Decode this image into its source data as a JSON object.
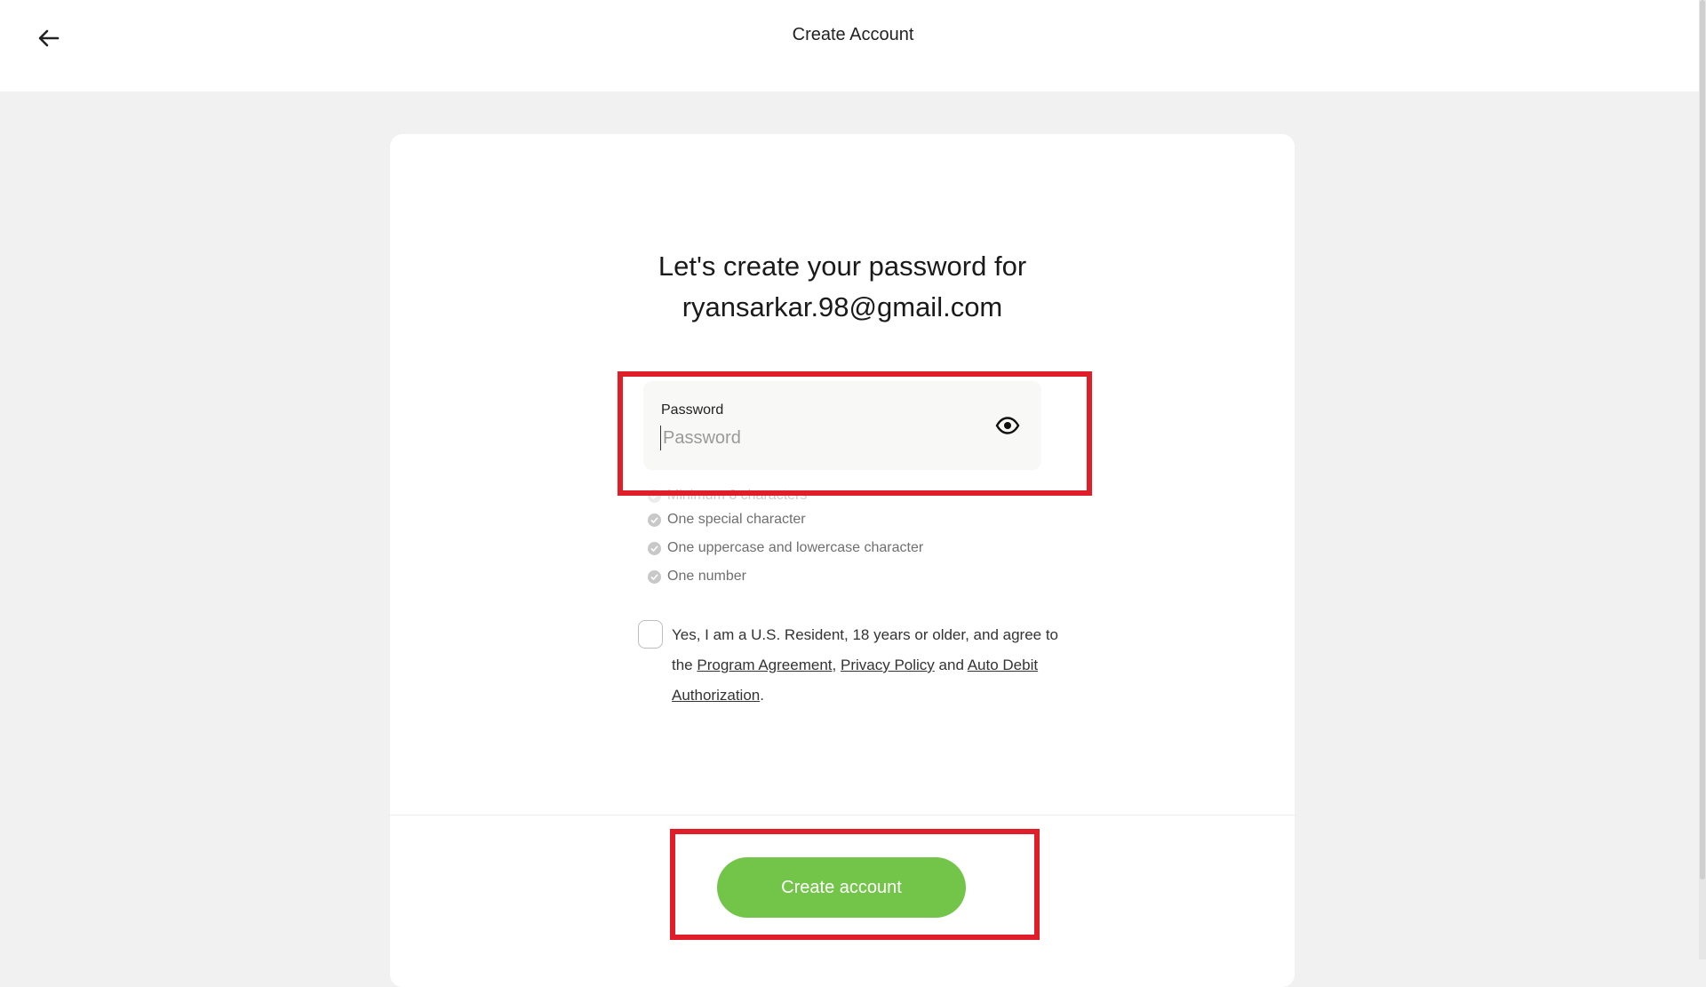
{
  "header": {
    "back_icon": "arrow-left-icon",
    "title": "Create Account"
  },
  "form": {
    "headline_line1": "Let's create your password for",
    "headline_line2": "ryansarkar.98@gmail.com",
    "password_label": "Password",
    "password_placeholder": "Password",
    "password_value": "",
    "visibility_icon": "eye-icon",
    "requirements": [
      "Minimum 8 characters",
      "One special character",
      "One uppercase and lowercase character",
      "One number"
    ],
    "consent": {
      "checked": false,
      "text_start": "Yes, I am a U.S. Resident, 18 years or older, and agree to the",
      "link_program": "Program Agreement",
      "sep_comma": ",",
      "link_privacy": "Privacy Policy",
      "sep_and": "and",
      "link_auto_debit": "Auto Debit Authorization",
      "end_period": "."
    },
    "submit_label": "Create account"
  },
  "colors": {
    "primary_button": "#72c548",
    "highlight": "#e01e2a"
  }
}
